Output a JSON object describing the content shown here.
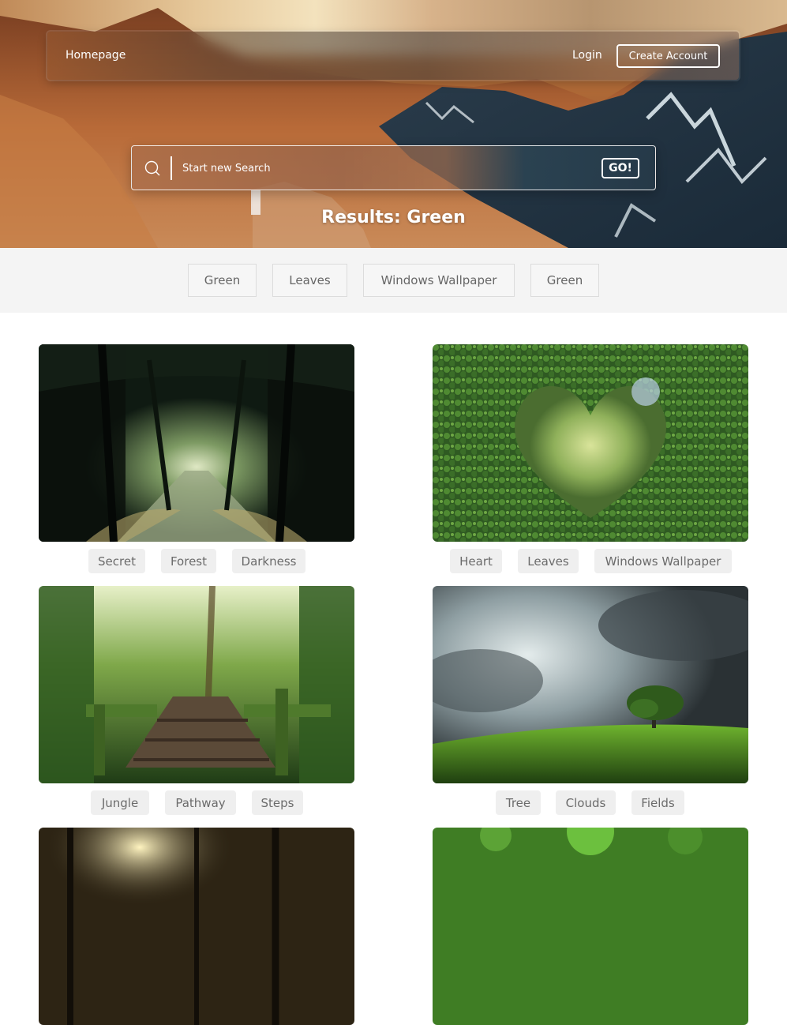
{
  "nav": {
    "homepage": "Homepage",
    "login": "Login",
    "create_account": "Create Account"
  },
  "search": {
    "placeholder": "Start new Search",
    "go": "GO!"
  },
  "results_title": "Results: Green",
  "related_tags": [
    "Green",
    "Leaves",
    "Windows Wallpaper",
    "Green"
  ],
  "cards": [
    {
      "image": "dark-forest-path",
      "tags": [
        "Secret",
        "Forest",
        "Darkness"
      ]
    },
    {
      "image": "heart-shaped-hedge",
      "tags": [
        "Heart",
        "Leaves",
        "Windows Wallpaper"
      ]
    },
    {
      "image": "jungle-wooden-steps",
      "tags": [
        "Jungle",
        "Pathway",
        "Steps"
      ]
    },
    {
      "image": "tree-on-hill-clouds",
      "tags": [
        "Tree",
        "Clouds",
        "Fields"
      ]
    },
    {
      "image": "sunlit-forest"
    },
    {
      "image": "green-foliage"
    }
  ]
}
